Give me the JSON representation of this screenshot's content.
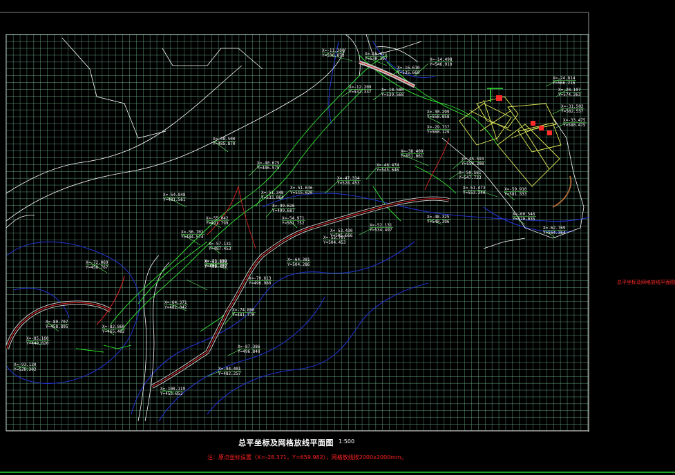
{
  "drawing": {
    "title": "总平坐标及网格放线平面图",
    "scale": "1:500",
    "note": "注：原点坐标设置（X=-28.371，Y=659.982），网格放线按2000x2000mm。",
    "side_label": "总平坐标及网格放线平面图"
  },
  "colors": {
    "background": "#000000",
    "grid": "#7fd0a6",
    "frame": "#ffffff",
    "outline": "#ffffff",
    "road_edge": "#33ee33",
    "path_center": "#cc2222",
    "path_edge": "#c8c8c8",
    "contour": "#2233cc",
    "building": "#e6f05a",
    "marker": "#ff2a2a",
    "title_text": "#ffffff",
    "note_text": "#ff2222"
  },
  "coordinates": [
    {
      "x": "X=-11.260",
      "y": "Y=536.873"
    },
    {
      "x": "X=-15.421",
      "y": "Y=530.397"
    },
    {
      "x": "X=-14.498",
      "y": "Y=546.910"
    },
    {
      "x": "X=-16.610",
      "y": "Y=535.660"
    },
    {
      "x": "X=-12.209",
      "y": "Y=532.337"
    },
    {
      "x": "X=-18.580",
      "y": "Y=539.568"
    },
    {
      "x": "X=-24.814",
      "y": "Y=566.216"
    },
    {
      "x": "X=-28.107",
      "y": "Y=574.263"
    },
    {
      "x": "X=-30.299",
      "y": "Y=558.058"
    },
    {
      "x": "X=-31.502",
      "y": "Y=582.557"
    },
    {
      "x": "X=-29.737",
      "y": "Y=560.129"
    },
    {
      "x": "X=-33.475",
      "y": "Y=580.475"
    },
    {
      "x": "X=-38.500",
      "y": "Y=485.870"
    },
    {
      "x": "X=-40.675",
      "y": "Y=486.575"
    },
    {
      "x": "X=-38.409",
      "y": "Y=551.061"
    },
    {
      "x": "X=-46.474",
      "y": "Y=545.646"
    },
    {
      "x": "X=-45.593",
      "y": "Y=554.208"
    },
    {
      "x": "X=-47.314",
      "y": "Y=528.453"
    },
    {
      "x": "X=-51.636",
      "y": "Y=515.620"
    },
    {
      "x": "X=-51.348",
      "y": "Y=533.064"
    },
    {
      "x": "X=-49.626",
      "y": "Y=499.687"
    },
    {
      "x": "X=-54.848",
      "y": "Y=481.561"
    },
    {
      "x": "X=-55.042",
      "y": "Y=491.799"
    },
    {
      "x": "X=-56.702",
      "y": "Y=484.574"
    },
    {
      "x": "X=-57.131",
      "y": "Y=487.453"
    },
    {
      "x": "X=-61.129",
      "y": "Y=492.492"
    },
    {
      "x": "X=-54.971",
      "y": "Y=501.752"
    },
    {
      "x": "X=-53.430",
      "y": "Y=505.666"
    },
    {
      "x": "X=-52.131",
      "y": "Y=534.497"
    },
    {
      "x": "X=-55.707",
      "y": "Y=504.453"
    },
    {
      "x": "X=-64.381",
      "y": "Y=504.286"
    },
    {
      "x": "X=-48.325",
      "y": "Y=540.396"
    },
    {
      "x": "X=-51.473",
      "y": "Y=553.340"
    },
    {
      "x": "X=-50.561",
      "y": "Y=547.733"
    },
    {
      "x": "X=-59.910",
      "y": "Y=581.333"
    },
    {
      "x": "X=-60.546",
      "y": "Y=570.035"
    },
    {
      "x": "X=-62.769",
      "y": "Y=564.364"
    },
    {
      "x": "X=-72.069",
      "y": "Y=458.767"
    },
    {
      "x": "X=-73.889",
      "y": "Y=488.207"
    },
    {
      "x": "X=-70.613",
      "y": "Y=496.980"
    },
    {
      "x": "X=-74.800",
      "y": "Y=481.770"
    },
    {
      "x": "X=-64.371",
      "y": "Y=482.042"
    },
    {
      "x": "X=-80.707",
      "y": "Y=458.895"
    },
    {
      "x": "X=-82.860",
      "y": "Y=465.462"
    },
    {
      "x": "X=-85.160",
      "y": "Y=449.820"
    },
    {
      "x": "X=-87.386",
      "y": "Y=496.840"
    },
    {
      "x": "X=-94.401",
      "y": "Y=482.257"
    },
    {
      "x": "X=-93.120",
      "y": "Y=526.302"
    },
    {
      "x": "X=-100.119",
      "y": "Y=455.852"
    }
  ]
}
